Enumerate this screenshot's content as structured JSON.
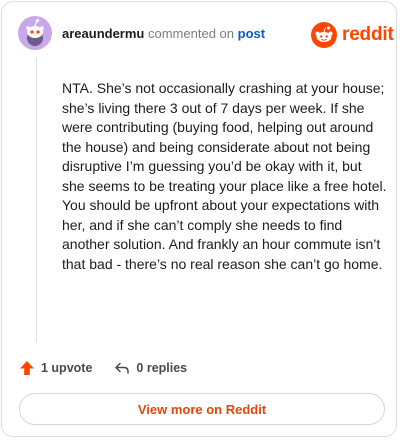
{
  "brand": {
    "name": "reddit",
    "accent": "#ff4500"
  },
  "comment": {
    "username": "areaundermu",
    "action_text": "commented on",
    "target_text": "post",
    "body": "NTA. She’s not occasionally crashing at your house; she’s living there 3 out of 7 days per week. If she were contributing (buying food, helping out around the house) and being considerate about not being disruptive I’m guessing you’d be okay with it, but she seems to be treating your place like a free hotel. You should be upfront about your expectations with her, and if she can’t comply she needs to find another solution. And frankly an hour commute isn’t that bad - there’s no real reason she can’t go home.",
    "upvote_label": "1 upvote",
    "replies_label": "0 replies"
  },
  "footer": {
    "view_more_label": "View more on Reddit"
  },
  "icons": {
    "avatar": "snoo-avatar-icon",
    "logo": "reddit-logo-icon",
    "upvote": "upvote-arrow-icon",
    "reply": "reply-arrow-icon"
  }
}
